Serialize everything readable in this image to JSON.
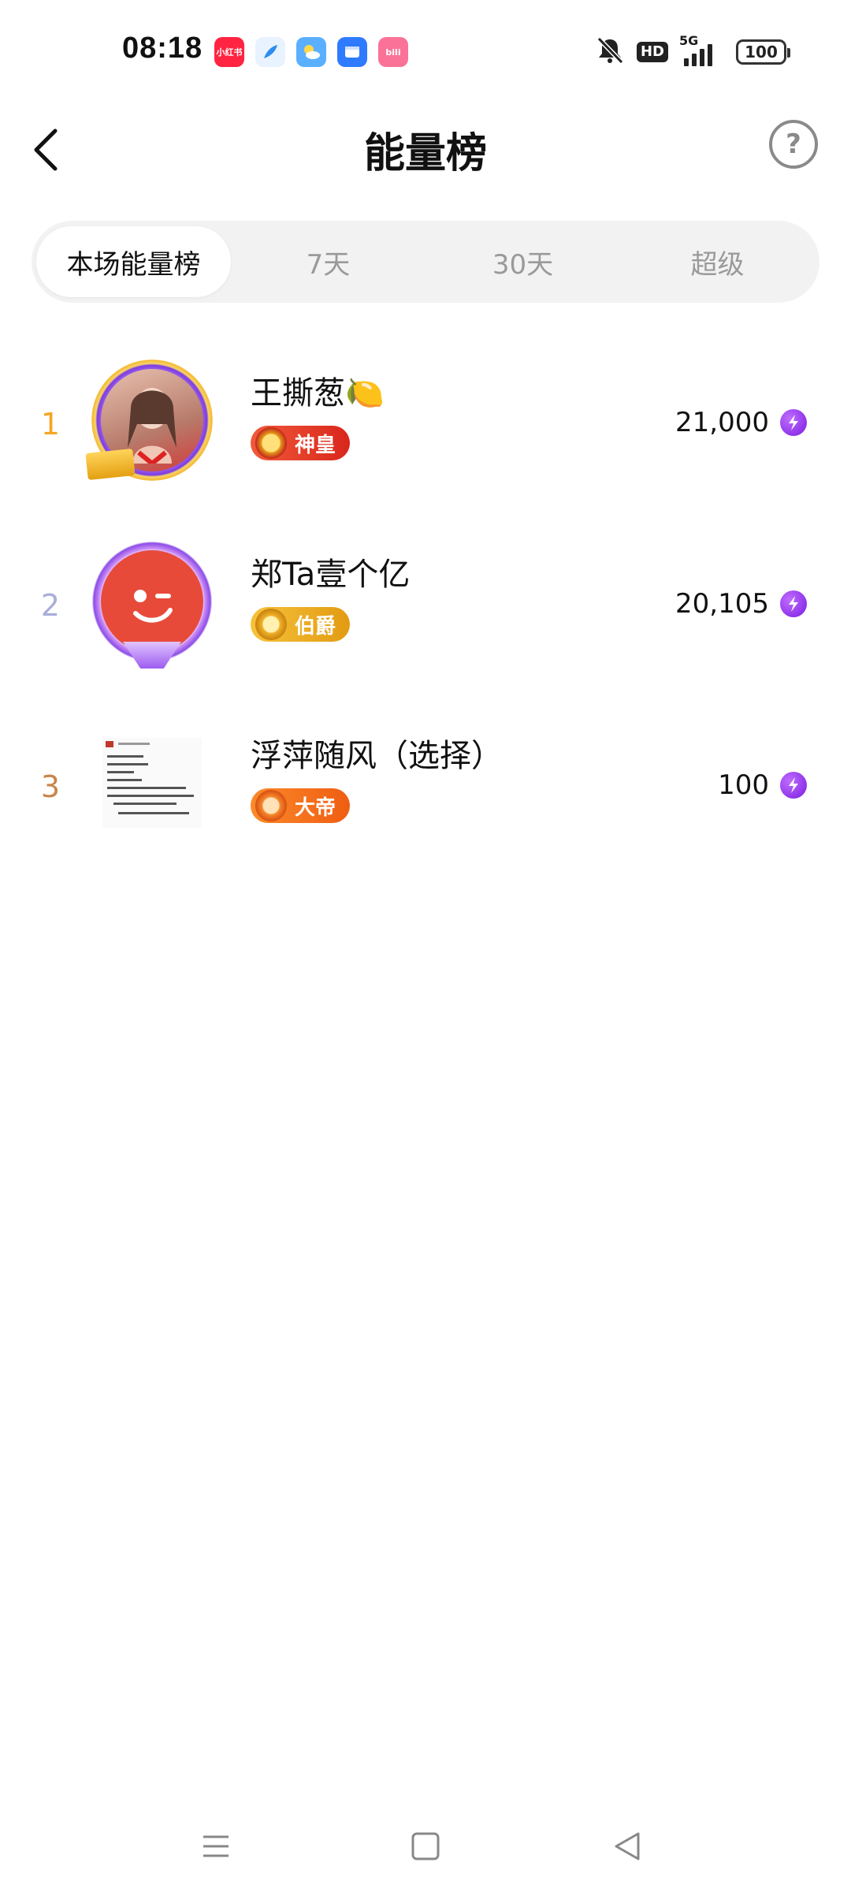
{
  "status_bar": {
    "time": "08:18",
    "notification_apps": [
      {
        "name": "xiaohongshu-icon",
        "label": "小红书",
        "color": "#ff2442"
      },
      {
        "name": "feather-app-icon",
        "label": "",
        "color": "#2d8cf0"
      },
      {
        "name": "weather-app-icon",
        "label": "",
        "color": "#5ab0ff"
      },
      {
        "name": "files-app-icon",
        "label": "",
        "color": "#2f7bff"
      },
      {
        "name": "bilibili-icon",
        "label": "bili",
        "color": "#fb7299"
      }
    ],
    "hd": "HD",
    "network": "5G",
    "battery": "100"
  },
  "header": {
    "title": "能量榜",
    "help_symbol": "?"
  },
  "tabs": [
    {
      "label": "本场能量榜",
      "active": true
    },
    {
      "label": "7天",
      "active": false
    },
    {
      "label": "30天",
      "active": false
    },
    {
      "label": "超级",
      "active": false
    }
  ],
  "ranking": [
    {
      "rank": "1",
      "rank_color": "#f5a623",
      "name": "王撕葱🍋",
      "badge": "神皇",
      "badge_color": "#ee3b2b",
      "score": "21,000",
      "avatar_ring_color": "#a36bf0"
    },
    {
      "rank": "2",
      "rank_color": "#a9aed8",
      "name": "郑Ta壹个亿",
      "badge": "伯爵",
      "badge_color": "#f0a81e",
      "score": "20,105",
      "avatar_ring_color": "#b174f4"
    },
    {
      "rank": "3",
      "rank_color": "#c8864a",
      "name": "浮萍随风（选择）",
      "badge": "大帝",
      "badge_color": "#f57321",
      "score": "100",
      "avatar_ring_color": "#ffffff"
    }
  ],
  "colors": {
    "accent_energy": "#8a2be2",
    "tab_bg": "#f2f2f2",
    "muted_text": "#9a9a9a"
  }
}
